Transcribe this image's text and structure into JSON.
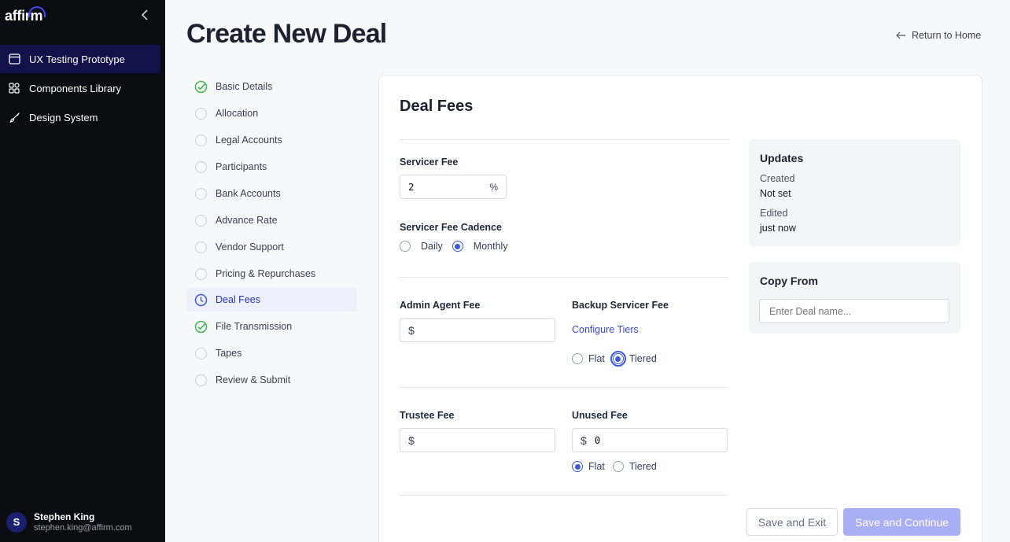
{
  "app": {
    "logo": "affirm",
    "user": {
      "initial": "S",
      "name": "Stephen King",
      "email": "stephen.king@affirm.com"
    }
  },
  "sidebar": {
    "items": [
      {
        "label": "UX Testing Prototype",
        "icon": "window-icon",
        "active": true
      },
      {
        "label": "Components Library",
        "icon": "grid-icon",
        "active": false
      },
      {
        "label": "Design System",
        "icon": "brush-icon",
        "active": false
      }
    ]
  },
  "header": {
    "title": "Create New Deal",
    "return_label": "Return to Home"
  },
  "steps": [
    {
      "label": "Basic Details",
      "status": "complete"
    },
    {
      "label": "Allocation",
      "status": "pending"
    },
    {
      "label": "Legal Accounts",
      "status": "pending"
    },
    {
      "label": "Participants",
      "status": "pending"
    },
    {
      "label": "Bank Accounts",
      "status": "pending"
    },
    {
      "label": "Advance Rate",
      "status": "pending"
    },
    {
      "label": "Vendor Support",
      "status": "pending"
    },
    {
      "label": "Pricing & Repurchases",
      "status": "pending"
    },
    {
      "label": "Deal Fees",
      "status": "current"
    },
    {
      "label": "File Transmission",
      "status": "complete"
    },
    {
      "label": "Tapes",
      "status": "pending"
    },
    {
      "label": "Review & Submit",
      "status": "pending"
    }
  ],
  "form": {
    "section_title": "Deal Fees",
    "servicer_fee": {
      "label": "Servicer Fee",
      "value": "2",
      "suffix": "%"
    },
    "servicer_fee_cadence": {
      "label": "Servicer Fee Cadence",
      "options": [
        "Daily",
        "Monthly"
      ],
      "selected": "Monthly"
    },
    "admin_agent_fee": {
      "label": "Admin Agent Fee",
      "prefix": "$",
      "value": ""
    },
    "backup_servicer_fee": {
      "label": "Backup Servicer Fee",
      "link": "Configure Tiers",
      "options": [
        "Flat",
        "Tiered"
      ],
      "selected": "Tiered"
    },
    "trustee_fee": {
      "label": "Trustee Fee",
      "prefix": "$",
      "value": ""
    },
    "unused_fee": {
      "label": "Unused Fee",
      "prefix": "$",
      "value": "0",
      "options": [
        "Flat",
        "Tiered"
      ],
      "selected": "Flat"
    }
  },
  "updates": {
    "title": "Updates",
    "created_label": "Created",
    "created_value": "Not set",
    "edited_label": "Edited",
    "edited_value": "just now"
  },
  "copy_from": {
    "title": "Copy From",
    "placeholder": "Enter Deal name..."
  },
  "actions": {
    "save_exit": "Save and Exit",
    "save_continue": "Save and Continue"
  },
  "colors": {
    "sidebar_bg": "#0b0b12",
    "active_nav": "#12124a",
    "accent": "#3b5bdb",
    "complete_green": "#3fb950",
    "primary_disabled": "#a9aef5"
  }
}
